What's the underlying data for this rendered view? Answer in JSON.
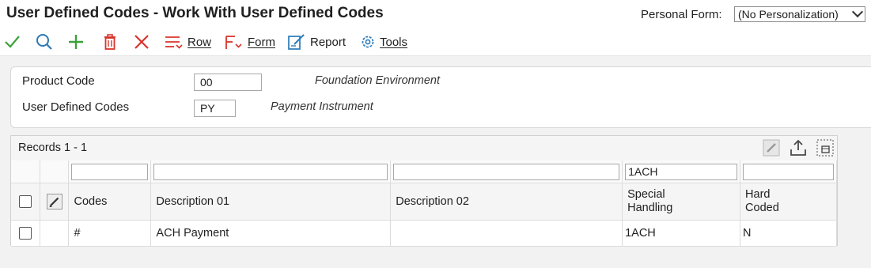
{
  "window": {
    "title": "User Defined Codes - Work With User Defined Codes"
  },
  "personal_form": {
    "label": "Personal Form:",
    "selected": "(No Personalization)"
  },
  "toolbar": {
    "icons": [
      "check-icon",
      "search-icon",
      "plus-icon",
      "trash-icon",
      "close-icon",
      "row-icon",
      "form-icon",
      "report-icon",
      "tools-icon"
    ],
    "row_label": "Row",
    "form_label": "Form",
    "report_label": "Report",
    "tools_label": "Tools",
    "colors": {
      "check": "#3aa13a",
      "search": "#2a7ab8",
      "add": "#3aa13a",
      "delete": "#d9342b",
      "cancel": "#d9342b",
      "menu_red": "#d9342b",
      "report": "#2a7ab8"
    }
  },
  "header": {
    "product_code": {
      "label": "Product Code",
      "value": "00",
      "description": "Foundation Environment"
    },
    "udc": {
      "label": "User Defined Codes",
      "value": "PY",
      "description": "Payment Instrument"
    }
  },
  "grid": {
    "records": "Records 1 - 1",
    "filters": {
      "codes": "",
      "description_01": "",
      "description_02": "",
      "special_handling": "1ACH",
      "hard_coded": ""
    },
    "columns": {
      "codes": "Codes",
      "description_01": "Description 01",
      "description_02": "Description 02",
      "special_handling": [
        "Special",
        "Handling"
      ],
      "hard_coded": [
        "Hard",
        "Coded"
      ]
    },
    "rows": [
      {
        "codes": "#",
        "description_01": "ACH Payment",
        "description_02": "",
        "special_handling": "1ACH",
        "hard_coded": "N"
      }
    ]
  }
}
